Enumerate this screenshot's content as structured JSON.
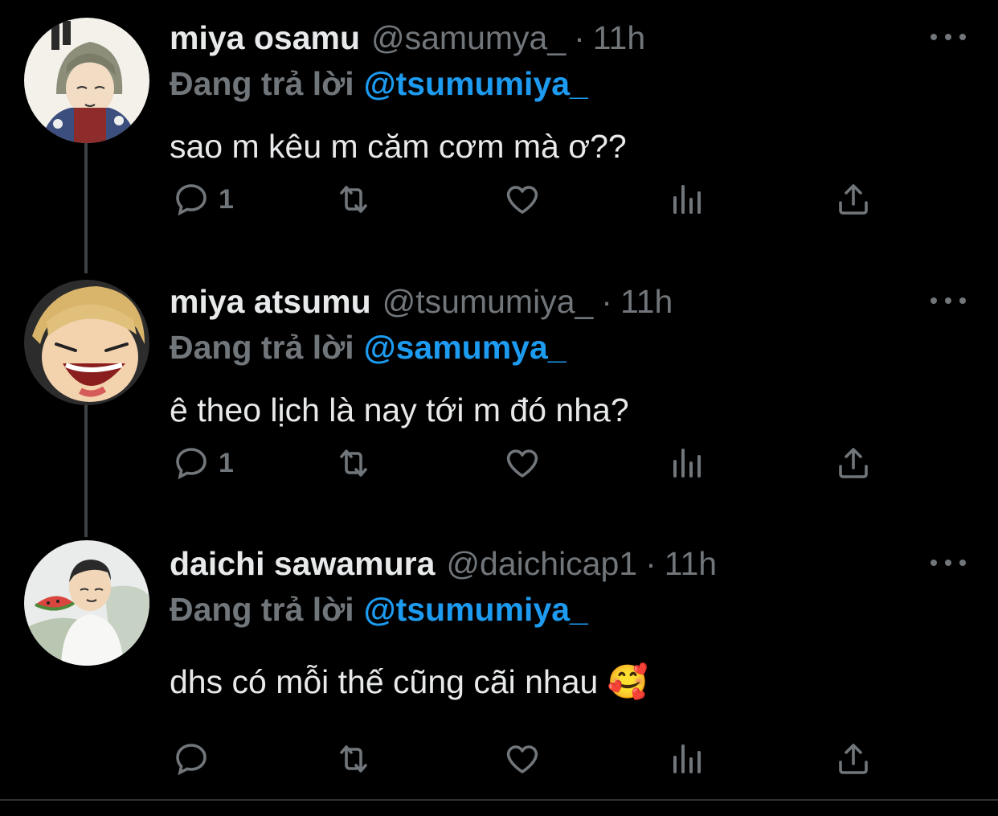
{
  "colors": {
    "background": "#000000",
    "text_primary": "#e7e9ea",
    "text_secondary": "#71767b",
    "link": "#1d9bf0",
    "thread_line": "#3e4144"
  },
  "tweets": [
    {
      "display_name": "miya osamu",
      "handle": "@samumya_",
      "separator": "·",
      "time": "11h",
      "reply_prefix": "Đang trả lời",
      "reply_to": "@tsumumiya_",
      "text": "sao m kêu m căm cơm mà ơ??",
      "reply_count": "1",
      "avatar": "avatar-osamu"
    },
    {
      "display_name": "miya atsumu",
      "handle": "@tsumumiya_",
      "separator": "·",
      "time": "11h",
      "reply_prefix": "Đang trả lời",
      "reply_to": "@samumya_",
      "text": "ê theo lịch là nay tới m đó nha?",
      "reply_count": "1",
      "avatar": "avatar-atsumu"
    },
    {
      "display_name": "daichi sawamura",
      "handle": "@daichicap1",
      "separator": "·",
      "time": "11h",
      "reply_prefix": "Đang trả lời",
      "reply_to": "@tsumumiya_",
      "text": "dhs có mỗi thế cũng cãi nhau 🥰",
      "reply_count": "",
      "avatar": "avatar-daichi"
    }
  ],
  "icons": {
    "reply": "reply-icon",
    "retweet": "retweet-icon",
    "like": "heart-icon",
    "views": "analytics-icon",
    "share": "share-icon",
    "more": "more-icon"
  }
}
